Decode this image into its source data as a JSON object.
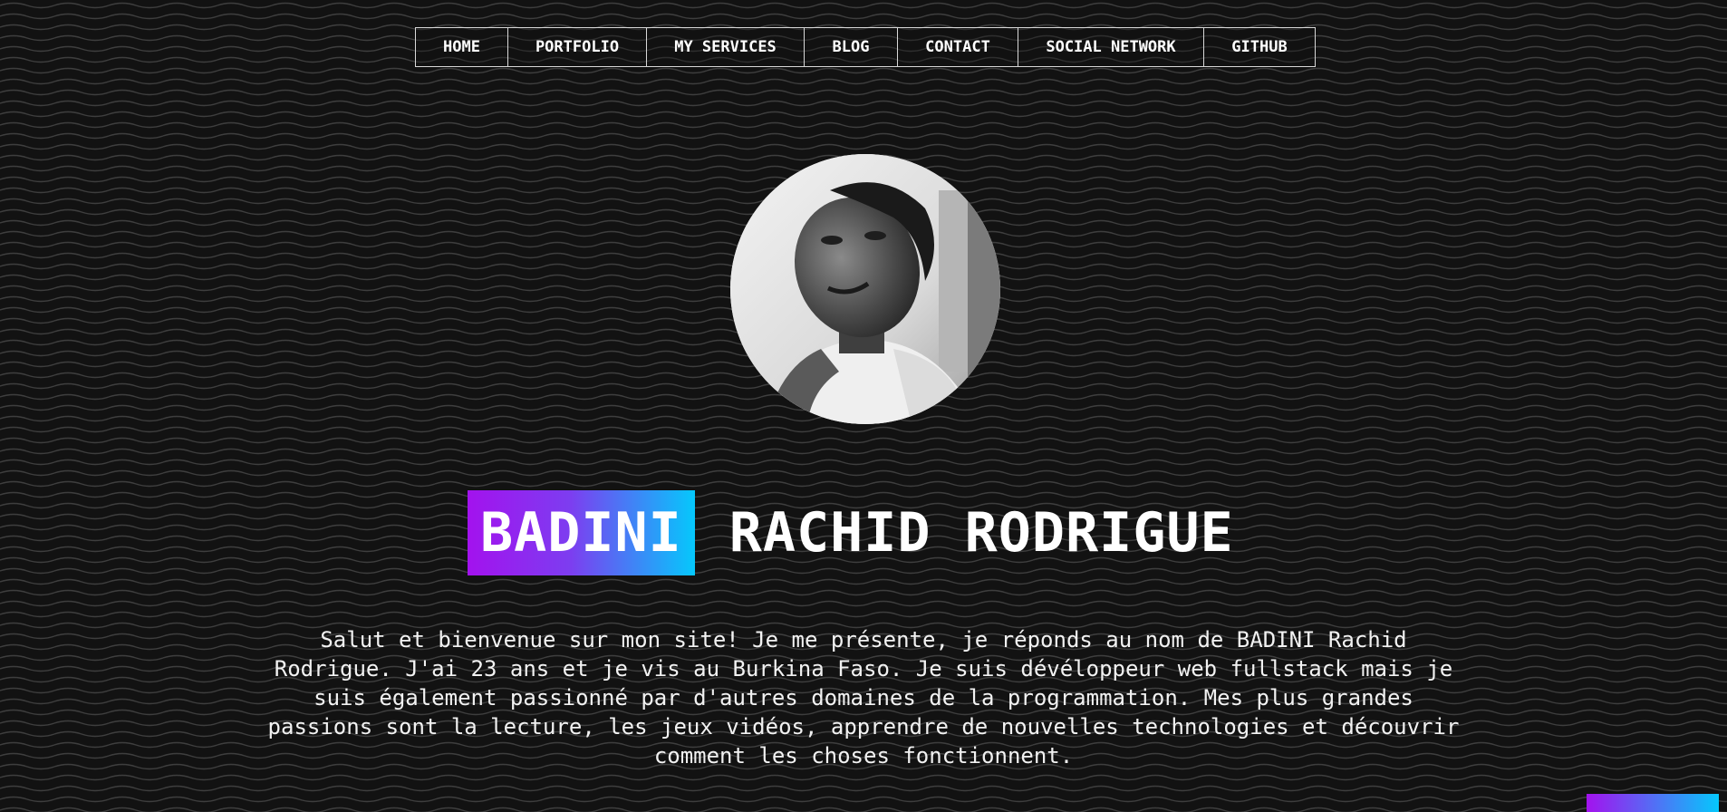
{
  "nav": {
    "items": [
      {
        "label": "HOME"
      },
      {
        "label": "PORTFOLIO"
      },
      {
        "label": "MY SERVICES"
      },
      {
        "label": "BLOG"
      },
      {
        "label": "CONTACT"
      },
      {
        "label": "SOCIAL NETWORK"
      },
      {
        "label": "GITHUB"
      }
    ]
  },
  "hero": {
    "name_highlight": "BADINI",
    "name_rest": "RACHID RODRIGUE",
    "intro": "Salut et bienvenue sur mon site! Je me présente, je réponds au nom de BADINI Rachid Rodrigue. J'ai 23 ans et je vis au Burkina Faso. Je suis dévéloppeur web fullstack mais je suis également passionné par d'autres domaines de la programmation. Mes plus grandes passions sont la lecture, les jeux vidéos, apprendre de nouvelles technologies et découvrir comment les choses fonctionnent."
  },
  "colors": {
    "background": "#121212",
    "accent_purple": "#a312ee",
    "accent_cyan": "#05c8fc",
    "text": "#ffffff"
  }
}
